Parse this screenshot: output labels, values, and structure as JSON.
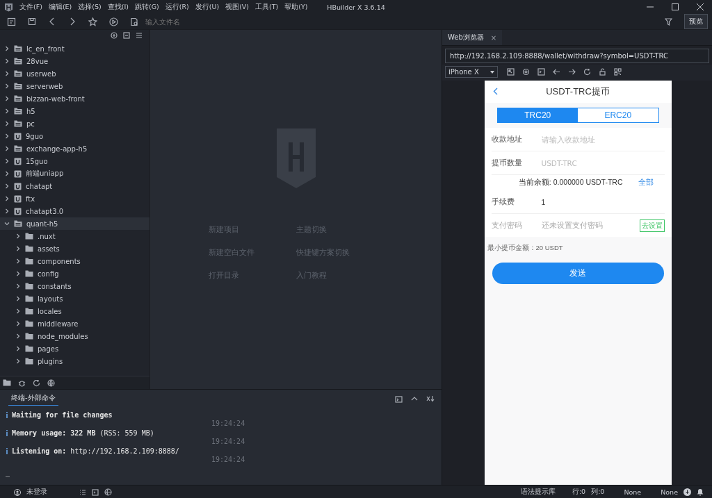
{
  "title_bar": {
    "menus": [
      "文件(F)",
      "编辑(E)",
      "选择(S)",
      "查找(I)",
      "跳转(G)",
      "运行(R)",
      "发行(U)",
      "视图(V)",
      "工具(T)",
      "帮助(Y)"
    ],
    "title": "HBuilder X 3.6.14"
  },
  "toolbar": {
    "file_search_placeholder": "输入文件名",
    "preview_button": "预览"
  },
  "sidebar": {
    "items": [
      {
        "label": "lc_en_front",
        "kind": "folder",
        "expanded": false,
        "selected": false
      },
      {
        "label": "28vue",
        "kind": "folder",
        "expanded": false,
        "selected": false
      },
      {
        "label": "userweb",
        "kind": "folder",
        "expanded": false,
        "selected": false
      },
      {
        "label": "serverweb",
        "kind": "folder",
        "expanded": false,
        "selected": false
      },
      {
        "label": "bizzan-web-front",
        "kind": "folder",
        "expanded": false,
        "selected": false
      },
      {
        "label": "h5",
        "kind": "folder",
        "expanded": false,
        "selected": false
      },
      {
        "label": "pc",
        "kind": "folder",
        "expanded": false,
        "selected": false
      },
      {
        "label": "9guo",
        "kind": "uniapp",
        "expanded": false,
        "selected": false
      },
      {
        "label": "exchange-app-h5",
        "kind": "folder",
        "expanded": false,
        "selected": false
      },
      {
        "label": "15guo",
        "kind": "uniapp",
        "expanded": false,
        "selected": false
      },
      {
        "label": "前端uniapp",
        "kind": "uniapp",
        "expanded": false,
        "selected": false
      },
      {
        "label": "chatapt",
        "kind": "uniapp",
        "expanded": false,
        "selected": false
      },
      {
        "label": "ftx",
        "kind": "uniapp",
        "expanded": false,
        "selected": false
      },
      {
        "label": "chatapt3.0",
        "kind": "uniapp",
        "expanded": false,
        "selected": false
      },
      {
        "label": "quant-h5",
        "kind": "folder",
        "expanded": true,
        "selected": true,
        "children": [
          {
            "label": ".nuxt",
            "kind": "dir",
            "expanded": false,
            "selected": false
          },
          {
            "label": "assets",
            "kind": "dir",
            "expanded": false,
            "selected": false
          },
          {
            "label": "components",
            "kind": "dir",
            "expanded": false,
            "selected": false
          },
          {
            "label": "config",
            "kind": "dir",
            "expanded": false,
            "selected": false
          },
          {
            "label": "constants",
            "kind": "dir",
            "expanded": false,
            "selected": false
          },
          {
            "label": "layouts",
            "kind": "dir",
            "expanded": false,
            "selected": false
          },
          {
            "label": "locales",
            "kind": "dir",
            "expanded": false,
            "selected": false
          },
          {
            "label": "middleware",
            "kind": "dir",
            "expanded": false,
            "selected": false
          },
          {
            "label": "node_modules",
            "kind": "dir",
            "expanded": false,
            "selected": false
          },
          {
            "label": "pages",
            "kind": "dir",
            "expanded": false,
            "selected": false
          },
          {
            "label": "plugins",
            "kind": "dir",
            "expanded": false,
            "selected": false
          }
        ]
      }
    ]
  },
  "welcome": {
    "links": [
      "新建项目",
      "主题切换",
      "新建空白文件",
      "快捷键方案切换",
      "打开目录",
      "入门教程"
    ]
  },
  "browser": {
    "tab": "Web浏览器",
    "tab_close": "×",
    "url": "http://192.168.2.109:8888/wallet/withdraw?symbol=USDT-TRC",
    "device": "iPhone X",
    "page": {
      "title": "USDT-TRC提币",
      "networks": [
        {
          "label": "TRC20",
          "selected": true
        },
        {
          "label": "ERC20",
          "selected": false
        }
      ],
      "fields": [
        {
          "label": "收款地址",
          "placeholder": "请输入收款地址"
        },
        {
          "label": "提币数量",
          "placeholder": "USDT-TRC"
        }
      ],
      "balance": "当前余额: 0.000000 USDT-TRC",
      "all_link": "全部",
      "fee_label": "手续费",
      "fee_value": "1",
      "password_label": "支付密码",
      "password_status": "还未设置支付密码",
      "set_button": "去设置",
      "minimum": "最小提币金额：20 USDT",
      "send_button": "发送"
    }
  },
  "terminal": {
    "tab": "终端-外部命令",
    "lines": [
      {
        "text": "**Waiting for file changes**",
        "time": "19:24:24"
      },
      {
        "text": "**Memory usage: 322 MB** (RSS: 559 MB)",
        "time": "19:24:24"
      },
      {
        "text": "**Listening on:** http://192.168.2.109:8888/",
        "time": "19:24:24"
      }
    ],
    "cursor": "_"
  },
  "status_bar": {
    "login": "未登录",
    "syntax": "语法提示库",
    "line": "行:0",
    "column": "列:0",
    "encoding": "None",
    "language": "None"
  }
}
